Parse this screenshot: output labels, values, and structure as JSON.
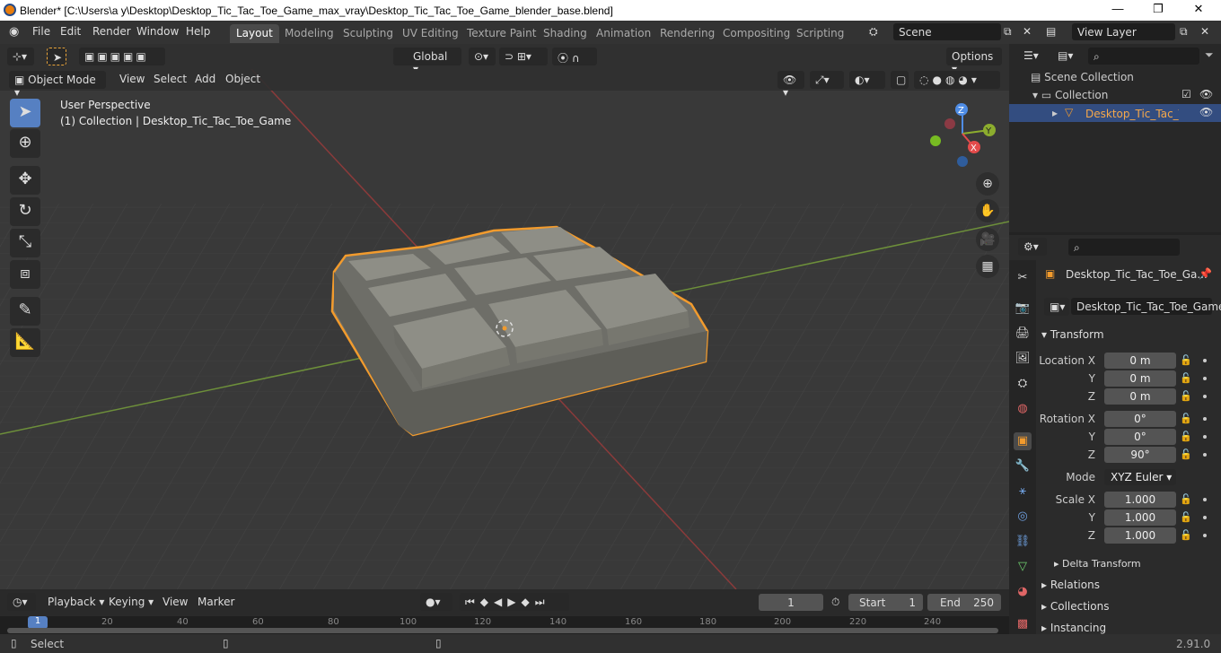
{
  "window": {
    "title": "Blender* [C:\\Users\\a y\\Desktop\\Desktop_Tic_Tac_Toe_Game_max_vray\\Desktop_Tic_Tac_Toe_Game_blender_base.blend]"
  },
  "menus": [
    "File",
    "Edit",
    "Render",
    "Window",
    "Help"
  ],
  "workspaces": [
    "Layout",
    "Modeling",
    "Sculpting",
    "UV Editing",
    "Texture Paint",
    "Shading",
    "Animation",
    "Rendering",
    "Compositing",
    "Scripting"
  ],
  "scene": "Scene",
  "view_layer": "View Layer",
  "header": {
    "transform_orientation": "Global",
    "options": "Options"
  },
  "viewport_header": {
    "mode": "Object Mode",
    "view": "View",
    "select": "Select",
    "add": "Add",
    "object": "Object"
  },
  "viewport": {
    "perspective": "User Perspective",
    "collection_info": "(1) Collection | Desktop_Tic_Tac_Toe_Game"
  },
  "gizmo": {
    "x": "X",
    "y": "Y",
    "z": "Z"
  },
  "outliner": {
    "scene_collection": "Scene Collection",
    "collection": "Collection",
    "object": "Desktop_Tic_Tac_Toe_Game"
  },
  "properties": {
    "object_name_short": "Desktop_Tic_Tac_Toe_Ga...",
    "object_name": "Desktop_Tic_Tac_Toe_Game",
    "transform": "Transform",
    "location_x_label": "Location X",
    "y_label": "Y",
    "z_label": "Z",
    "location": [
      "0 m",
      "0 m",
      "0 m"
    ],
    "rotation_x_label": "Rotation X",
    "rotation": [
      "0°",
      "0°",
      "90°"
    ],
    "mode_label": "Mode",
    "mode": "XYZ Euler",
    "scale_x_label": "Scale X",
    "scale": [
      "1.000",
      "1.000",
      "1.000"
    ],
    "delta_transform": "Delta Transform",
    "relations": "Relations",
    "collections": "Collections",
    "instancing": "Instancing"
  },
  "timeline": {
    "playback": "Playback",
    "keying": "Keying",
    "view": "View",
    "marker": "Marker",
    "current_frame": "1",
    "start_label": "Start",
    "start": "1",
    "end_label": "End",
    "end": "250",
    "ticks": [
      "1",
      "20",
      "40",
      "60",
      "80",
      "100",
      "120",
      "140",
      "160",
      "180",
      "200",
      "220",
      "240"
    ]
  },
  "status": {
    "select": "Select",
    "version": "2.91.0"
  },
  "colors": {
    "selection": "#f29b2d",
    "object": "#7d7d75",
    "active_tab": "#5680c2"
  }
}
